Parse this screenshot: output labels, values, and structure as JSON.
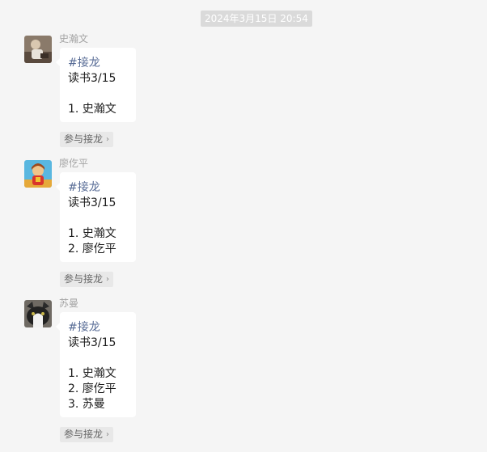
{
  "timestamp": "2024年3月15日 20:54",
  "join_label": "参与接龙",
  "messages": [
    {
      "sender": "史瀚文",
      "tag": "#接龙",
      "title": "读书3/15",
      "entries": [
        "1. 史瀚文"
      ]
    },
    {
      "sender": "廖仡平",
      "tag": "#接龙",
      "title": "读书3/15",
      "entries": [
        "1. 史瀚文",
        "2. 廖仡平"
      ]
    },
    {
      "sender": "苏曼",
      "tag": "#接龙",
      "title": "读书3/15",
      "entries": [
        "1. 史瀚文",
        "2. 廖仡平",
        "3. 苏曼"
      ]
    }
  ]
}
